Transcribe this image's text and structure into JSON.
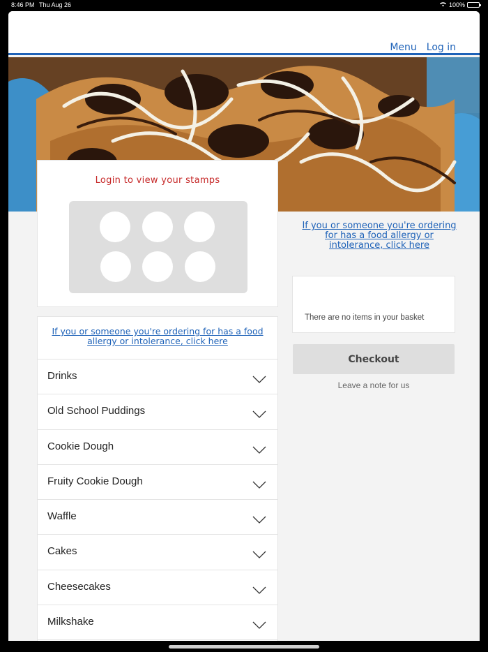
{
  "status_bar": {
    "time": "8:46 PM",
    "date": "Thu Aug 26",
    "battery": "100%",
    "battery_level": 1.0
  },
  "nav": {
    "menu": "Menu",
    "login": "Log in"
  },
  "hero": {
    "image": "waffle-with-chocolate-drizzle"
  },
  "stamps": {
    "title": "Login to view your stamps",
    "count": 6
  },
  "allergy_notice": "If you or someone you're ordering for has a food allergy or intolerance, click here",
  "categories": [
    {
      "label": "Drinks"
    },
    {
      "label": "Old School Puddings"
    },
    {
      "label": "Cookie Dough"
    },
    {
      "label": "Fruity Cookie Dough"
    },
    {
      "label": "Waffle"
    },
    {
      "label": "Cakes"
    },
    {
      "label": "Cheesecakes"
    },
    {
      "label": "Milkshake"
    }
  ],
  "basket": {
    "empty_text": "There are no items in your basket"
  },
  "checkout": {
    "label": "Checkout",
    "note": "Leave a note for us"
  },
  "colors": {
    "brand_blue": "#1e62b8",
    "stamp_red": "#c62828",
    "page_bg": "#f3f3f3"
  }
}
